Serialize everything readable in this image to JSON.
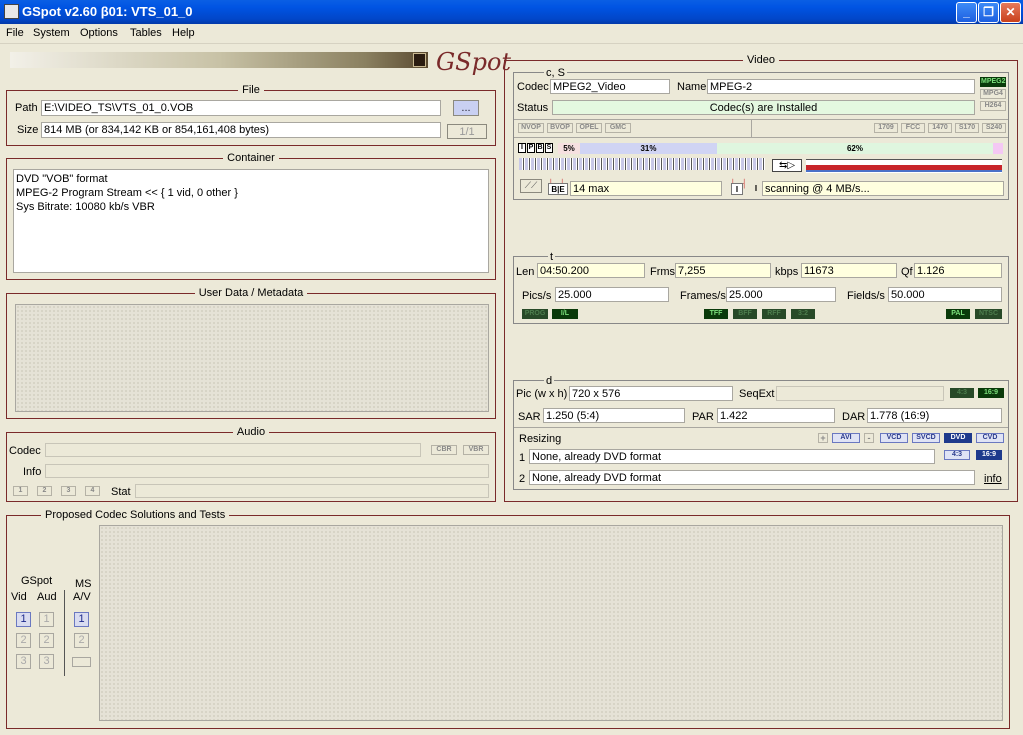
{
  "window": {
    "title": "GSpot v2.60 β01: VTS_01_0"
  },
  "menu": [
    "File",
    "System",
    "Options",
    "Tables",
    "Help"
  ],
  "logo": {
    "text": "GSpot"
  },
  "file": {
    "title": "File",
    "path_label": "Path",
    "path_value": "E:\\VIDEO_TS\\VTS_01_0.VOB",
    "browse_label": "...",
    "size_label": "Size",
    "size_value": "814 MB (or 834,142 KB or 854,161,408 bytes)",
    "page_label": "1/1"
  },
  "container": {
    "title": "Container",
    "lines": [
      "DVD \"VOB\" format",
      "MPEG-2 Program Stream << { 1 vid, 0 other }",
      "Sys Bitrate: 10080 kb/s VBR"
    ]
  },
  "userdata": {
    "title": "User Data / Metadata"
  },
  "audio": {
    "title": "Audio",
    "codec_label": "Codec",
    "cbr": "CBR",
    "vbr": "VBR",
    "info_label": "Info",
    "tracks": [
      "1",
      "2",
      "3",
      "4"
    ],
    "stat_label": "Stat"
  },
  "proposed": {
    "title": "Proposed Codec Solutions and Tests",
    "gspot_label": "GSpot",
    "vid_label": "Vid",
    "aud_label": "Aud",
    "ms_label": "MS",
    "av_label": "A/V",
    "vid": [
      "1",
      "2",
      "3"
    ],
    "aud": [
      "1",
      "2",
      "3"
    ],
    "ms": [
      "1",
      "2"
    ]
  },
  "video": {
    "title": "Video",
    "cs_title": "c, S",
    "codec_label": "Codec",
    "codec_value": "MPEG2_Video",
    "name_label": "Name",
    "name_value": "MPEG-2",
    "fmt_badges": [
      "MPEG2",
      "MPG4",
      "H264"
    ],
    "status_label": "Status",
    "status_value": "Codec(s) are Installed",
    "flags_left": [
      "NVOP",
      "BVOP",
      "OPEL",
      "GMC"
    ],
    "flags_right": [
      "1709",
      "FCC",
      "1470",
      "S170",
      "S240"
    ],
    "frame_types": [
      "I",
      "P",
      "B",
      "S"
    ],
    "pct1": "5%",
    "pct2": "31%",
    "pct3": "62%",
    "be_label": "B|E",
    "gop_value": "14 max",
    "scan_value": "scanning @ 4 MB/s...",
    "t_title": "t",
    "len_label": "Len",
    "len_value": "04:50.200",
    "frms_label": "Frms",
    "frms_value": "7,255",
    "kbps_label": "kbps",
    "kbps_value": "11673",
    "qf_label": "Qf",
    "qf_value": "1.126",
    "pics_label": "Pics/s",
    "pics_value": "25.000",
    "frames_label": "Frames/s",
    "frames_value": "25.000",
    "fields_label": "Fields/s",
    "fields_value": "50.000",
    "t_badges_left": [
      "PROG",
      "I/L"
    ],
    "t_badges_mid": [
      "TFF",
      "BFF",
      "RFF",
      "3:2"
    ],
    "t_badges_right": [
      "PAL",
      "NTSC"
    ],
    "d_title": "d",
    "pic_label": "Pic (w x h)",
    "pic_value": "720 x 576",
    "seqext_label": "SeqExt",
    "ar_badges": [
      "4:3",
      "16:9"
    ],
    "sar_label": "SAR",
    "sar_value": "1.250 (5:4)",
    "par_label": "PAR",
    "par_value": "1.422",
    "dar_label": "DAR",
    "dar_value": "1.778 (16:9)",
    "resizing_label": "Resizing",
    "resize_btns": [
      "+",
      "AVI",
      "-",
      "VCD",
      "SVCD",
      "DVD",
      "CVD"
    ],
    "r1_label": "1",
    "r1_value": "None, already DVD format",
    "r2_label": "2",
    "r2_value": "None, already DVD format",
    "r_badges": [
      "4:3",
      "16:9"
    ],
    "info_link": "info"
  }
}
